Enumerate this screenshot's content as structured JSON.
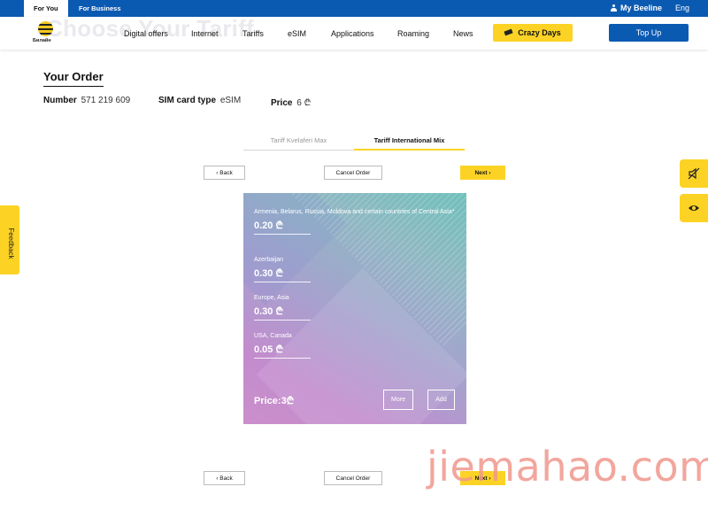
{
  "topbar": {
    "segments": [
      "For You",
      "For Business"
    ],
    "my_beeline": "My Beeline",
    "language": "Eng"
  },
  "nav": {
    "ghost_heading": "Choose Your Tariff",
    "logo_text": "Билайн",
    "items": [
      "Digital offers",
      "Internet",
      "Tariffs",
      "eSIM",
      "Applications",
      "Roaming",
      "News"
    ],
    "crazy_days": "Crazy Days",
    "top_up": "Top Up"
  },
  "order": {
    "title": "Your Order",
    "number_label": "Number",
    "number_value": "571 219 609",
    "sim_label": "SIM card type",
    "sim_value": "eSIM",
    "price_label": "Price",
    "price_value": "6 ₾"
  },
  "tabs": [
    "Tariff Kvelaferi Max",
    "Tariff International Mix"
  ],
  "active_tab": 1,
  "buttons": {
    "back": "‹ Back",
    "cancel": "Cancel Order",
    "next": "Next ›"
  },
  "card": {
    "rates": [
      {
        "country": "Armenia, Belarus, Russia, Moldova and certain countries of Central Asia*",
        "price": "0.20 ₾"
      },
      {
        "country": "Azerbaijan",
        "price": "0.30 ₾"
      },
      {
        "country": "Europe, Asia",
        "price": "0.30 ₾"
      },
      {
        "country": "USA, Canada",
        "price": "0.05 ₾"
      }
    ],
    "price": "Price:3₾",
    "more": "More",
    "add": "Add"
  },
  "feedback": "Feedback",
  "side_icons": [
    "no-sound-icon",
    "eye-icon"
  ],
  "watermark": "jiemahao.com",
  "colors": {
    "brand_yellow": "#fcd324",
    "brand_blue": "#0b5ab2"
  }
}
